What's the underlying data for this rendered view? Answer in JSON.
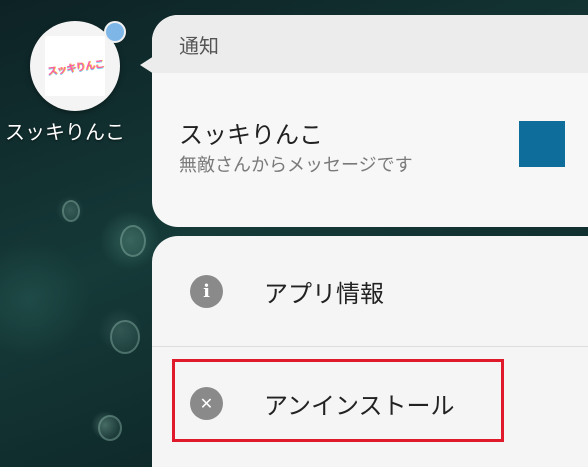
{
  "app": {
    "name": "スッキりんこ",
    "icon_name": "app-logo-icon",
    "logo_text": "スッキりんこ",
    "badge_color": "#7fb6e8"
  },
  "notification": {
    "header": "通知",
    "title": "スッキりんこ",
    "message": "無敵さんからメッセージです",
    "thumbnail_color": "#0e6d9b"
  },
  "menu": {
    "items": [
      {
        "label": "アプリ情報",
        "icon": "info-icon",
        "glyph": "i"
      },
      {
        "label": "アンインストール",
        "icon": "close-circle-icon",
        "glyph": "✕"
      }
    ]
  },
  "highlight_color": "#e01a2a"
}
